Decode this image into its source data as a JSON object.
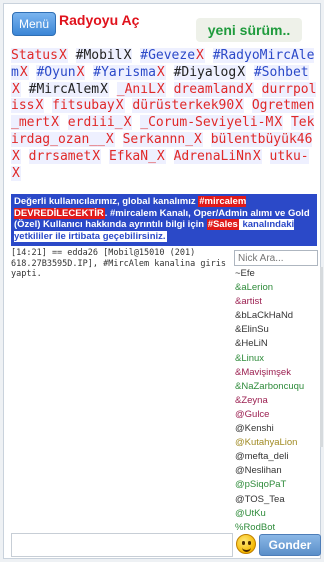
{
  "header": {
    "menu_label": "Menü",
    "title": "Radyoyu Aç",
    "update_label": "yeni sürüm.."
  },
  "tabs": [
    {
      "name": "Status",
      "type": "user"
    },
    {
      "name": "#Mobil",
      "type": "active"
    },
    {
      "name": "#Geveze",
      "type": "channel"
    },
    {
      "name": "#RadyoMircAlem",
      "type": "channel"
    },
    {
      "name": "#Oyun",
      "type": "channel"
    },
    {
      "name": "#Yarisma",
      "type": "channel"
    },
    {
      "name": "#Diyalog",
      "type": "active"
    },
    {
      "name": "#Sohbet",
      "type": "channel"
    },
    {
      "name": "#MircAlem",
      "type": "active"
    },
    {
      "name": "_AnıL",
      "type": "user"
    },
    {
      "name": "dreamland",
      "type": "user"
    },
    {
      "name": "durrpoliss",
      "type": "user"
    },
    {
      "name": "fitsubay",
      "type": "user"
    },
    {
      "name": "dürüsterkek90",
      "type": "user"
    },
    {
      "name": "Ogretmen_mert",
      "type": "user"
    },
    {
      "name": "erdiii_",
      "type": "user"
    },
    {
      "name": "_Corum-Seviyeli-M",
      "type": "user"
    },
    {
      "name": "Tekirdag_ozan__",
      "type": "user"
    },
    {
      "name": "Serkannn_",
      "type": "user"
    },
    {
      "name": "bülentbüyük46",
      "type": "user"
    },
    {
      "name": "drrsamet",
      "type": "user"
    },
    {
      "name": "EfkaN_",
      "type": "user"
    },
    {
      "name": "AdrenaLiNn",
      "type": "user"
    },
    {
      "name": "utku-",
      "type": "user"
    }
  ],
  "notice": {
    "p1": " Değerli kullanıcılarımız, global kanalımız ",
    "h1": "#mircalem DEVREDİLECEKTİR",
    "p2": ". ",
    "b1": "#mircalem",
    "p3": " Kanalı, ",
    "b2": "Oper/Admin",
    "p4": " alımı ve ",
    "b3": "Gold (Özel) Kullanıcı",
    "p5": " hakkında ayrıntılı bilgi için ",
    "h2": "#Sales",
    "p6": " kanalındaki yetkililer ile irtibata geçebilirsiniz. "
  },
  "chat": {
    "line": "[14:21] == edda26 [Mobil@15010 (201) 618.27B3595D.IP], #MircAlem kanalina giris yapti."
  },
  "nick_search": {
    "placeholder": "Nick Ara..."
  },
  "nicks": [
    {
      "name": "~Efe",
      "color": "#333333"
    },
    {
      "name": "&aLerion",
      "color": "#2e8b3a"
    },
    {
      "name": "&artist",
      "color": "#9b1f50"
    },
    {
      "name": "&bLaCkHaNd",
      "color": "#333333"
    },
    {
      "name": "&ElinSu",
      "color": "#333333"
    },
    {
      "name": "&HeLiN",
      "color": "#333333"
    },
    {
      "name": "&Linux",
      "color": "#2e8b3a"
    },
    {
      "name": "&Mavişimşek",
      "color": "#9b1f50"
    },
    {
      "name": "&NaZarboncuqu",
      "color": "#2e8b3a"
    },
    {
      "name": "&Zeyna",
      "color": "#9b1f50"
    },
    {
      "name": "@Gulce",
      "color": "#9b1f50"
    },
    {
      "name": "@Kenshi",
      "color": "#333333"
    },
    {
      "name": "@KutahyaLion",
      "color": "#a08a22"
    },
    {
      "name": "@mefta_deli",
      "color": "#333333"
    },
    {
      "name": "@Neslihan",
      "color": "#333333"
    },
    {
      "name": "@pSiqoPaT",
      "color": "#2e8b3a"
    },
    {
      "name": "@TOS_Tea",
      "color": "#333333"
    },
    {
      "name": "@UtKu",
      "color": "#2e8b3a"
    },
    {
      "name": "%RodBot",
      "color": "#2e8b3a"
    }
  ],
  "send_label": "Gonder"
}
